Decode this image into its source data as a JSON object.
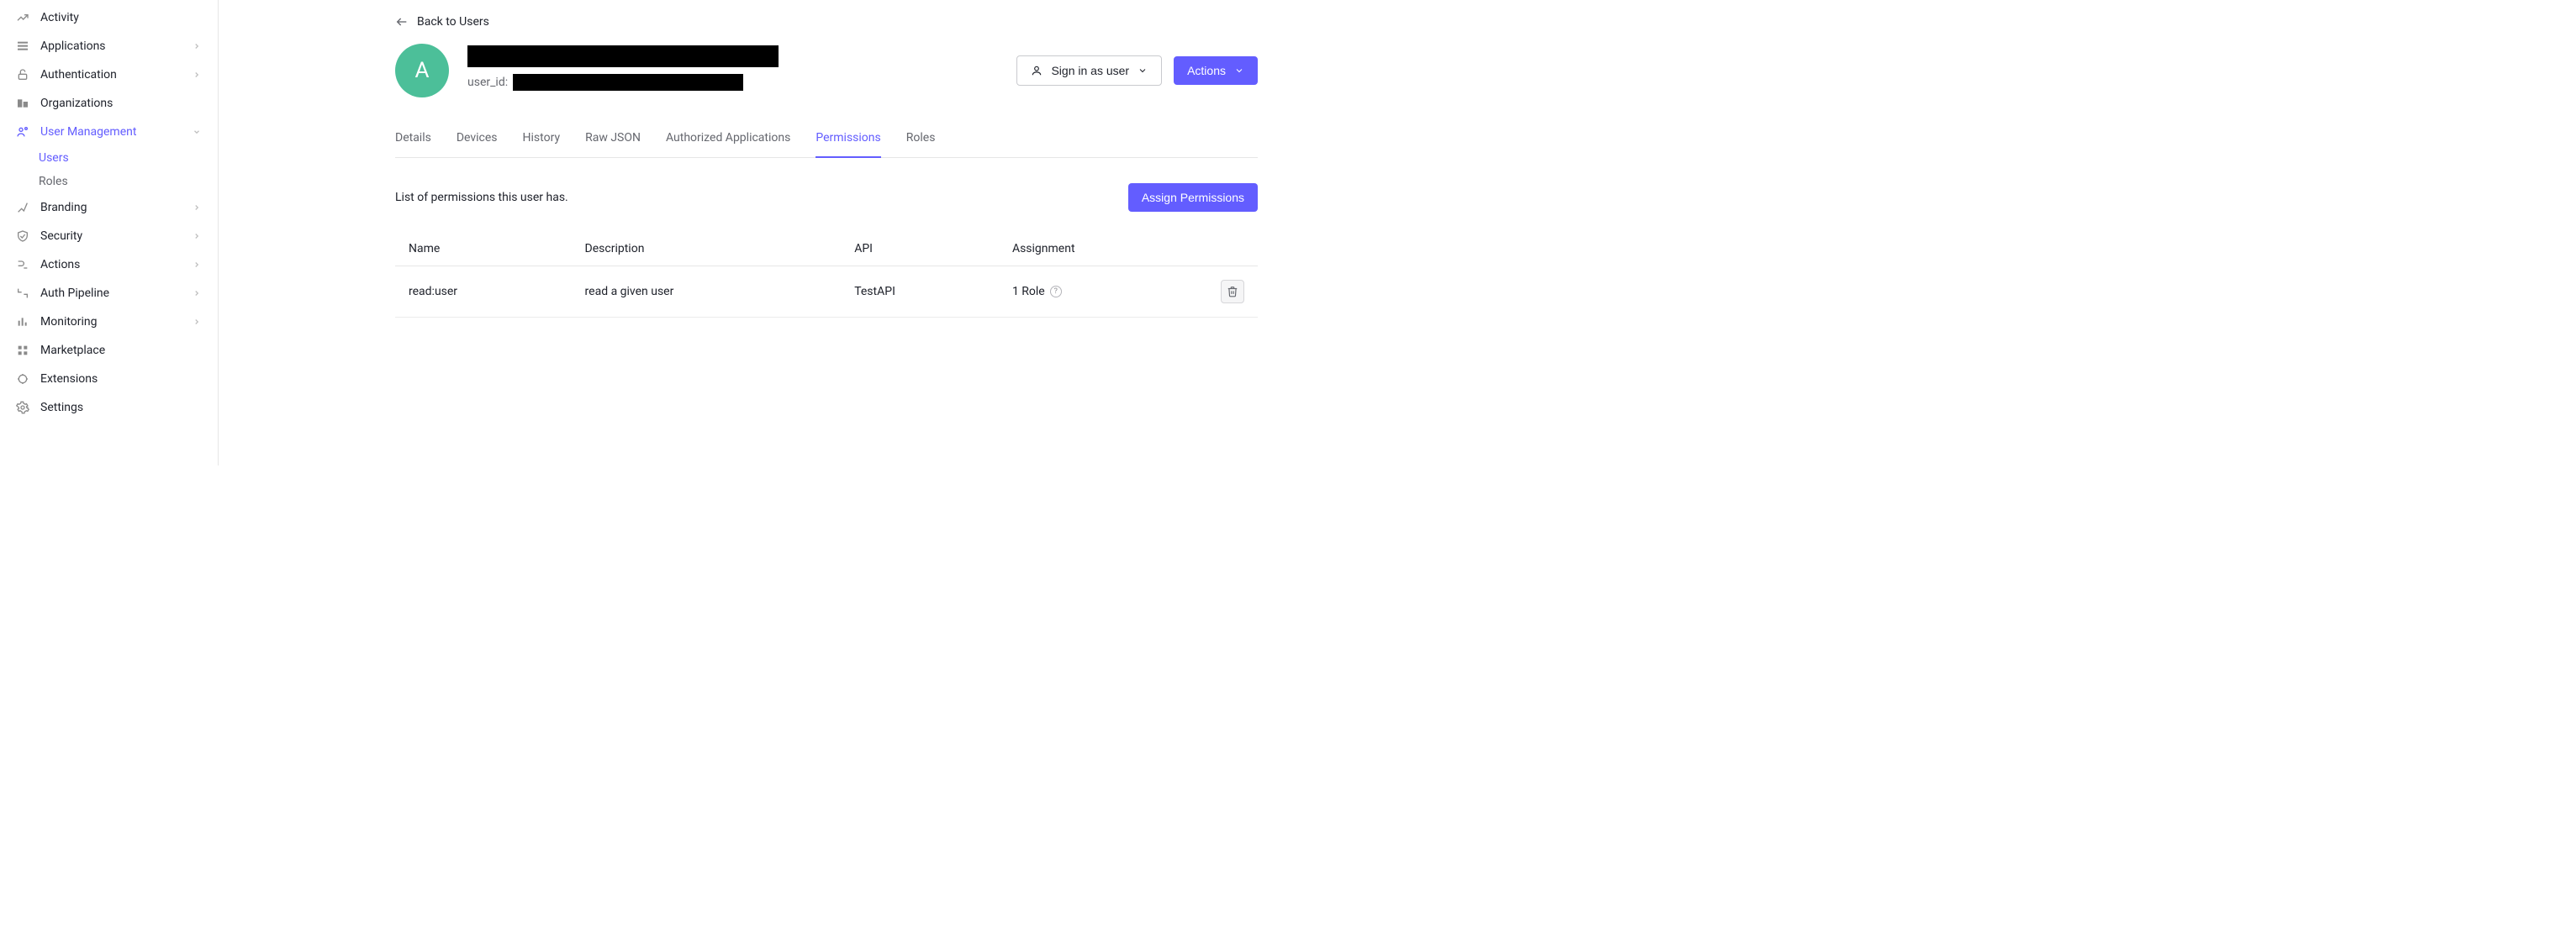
{
  "sidebar": {
    "items": [
      {
        "label": "Activity",
        "icon": "activity",
        "expandable": false
      },
      {
        "label": "Applications",
        "icon": "applications",
        "expandable": true
      },
      {
        "label": "Authentication",
        "icon": "authentication",
        "expandable": true
      },
      {
        "label": "Organizations",
        "icon": "organizations",
        "expandable": false
      },
      {
        "label": "User Management",
        "icon": "user-management",
        "expandable": true,
        "active": true,
        "children": [
          {
            "label": "Users",
            "active": true
          },
          {
            "label": "Roles"
          }
        ]
      },
      {
        "label": "Branding",
        "icon": "branding",
        "expandable": true
      },
      {
        "label": "Security",
        "icon": "security",
        "expandable": true
      },
      {
        "label": "Actions",
        "icon": "actions",
        "expandable": true
      },
      {
        "label": "Auth Pipeline",
        "icon": "auth-pipeline",
        "expandable": true
      },
      {
        "label": "Monitoring",
        "icon": "monitoring",
        "expandable": true
      },
      {
        "label": "Marketplace",
        "icon": "marketplace",
        "expandable": false
      },
      {
        "label": "Extensions",
        "icon": "extensions",
        "expandable": false
      },
      {
        "label": "Settings",
        "icon": "settings",
        "expandable": false
      }
    ]
  },
  "back_label": "Back to Users",
  "user": {
    "avatar_letter": "A",
    "user_id_label": "user_id:"
  },
  "header_actions": {
    "sign_in_label": "Sign in as user",
    "actions_label": "Actions"
  },
  "tabs": [
    {
      "label": "Details"
    },
    {
      "label": "Devices"
    },
    {
      "label": "History"
    },
    {
      "label": "Raw JSON"
    },
    {
      "label": "Authorized Applications"
    },
    {
      "label": "Permissions",
      "active": true
    },
    {
      "label": "Roles"
    }
  ],
  "permissions": {
    "description": "List of permissions this user has.",
    "assign_button": "Assign Permissions",
    "columns": {
      "name": "Name",
      "description": "Description",
      "api": "API",
      "assignment": "Assignment"
    },
    "rows": [
      {
        "name": "read:user",
        "description": "read a given user",
        "api": "TestAPI",
        "assignment": "1 Role"
      }
    ]
  }
}
